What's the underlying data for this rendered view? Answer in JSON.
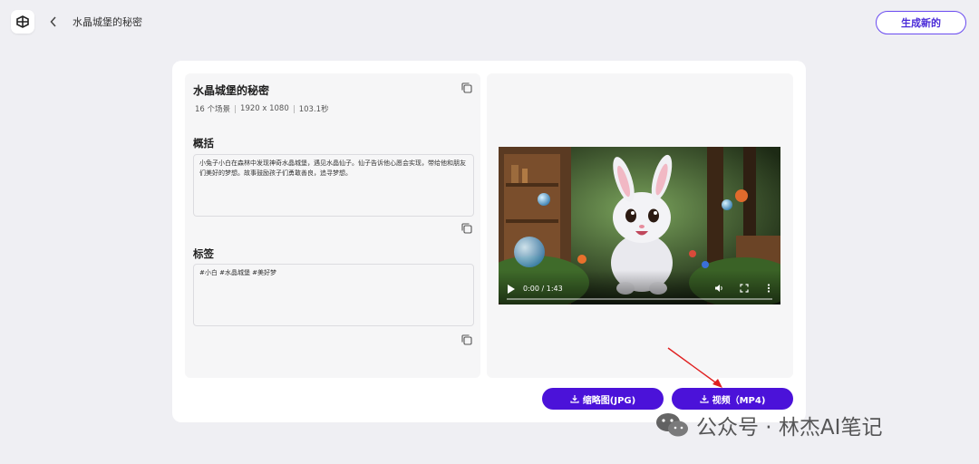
{
  "header": {
    "page_title": "水晶城堡的秘密",
    "generate_label": "生成新的"
  },
  "details": {
    "title": "水晶城堡的秘密",
    "scenes": "16 个场景",
    "resolution": "1920 x 1080",
    "duration": "103.1秒",
    "summary_label": "概括",
    "summary_text": "小兔子小白在森林中发现神奇水晶城堡，遇见水晶仙子。仙子告诉他心愿会实现，带给他和朋友们美好的梦想。故事鼓励孩子们勇敢善良，追寻梦想。",
    "tags_label": "标签",
    "tags_text": "#小白 #水晶城堡 #美好梦"
  },
  "player": {
    "time": "0:00 / 1:43",
    "progress": 0
  },
  "downloads": {
    "thumbnail_label": "缩略图(JPG)",
    "video_label": "视频（MP4)"
  },
  "watermark": {
    "text": "公众号 · 林杰AI笔记"
  },
  "colors": {
    "accent": "#4b12d9",
    "background": "#efeff3"
  }
}
